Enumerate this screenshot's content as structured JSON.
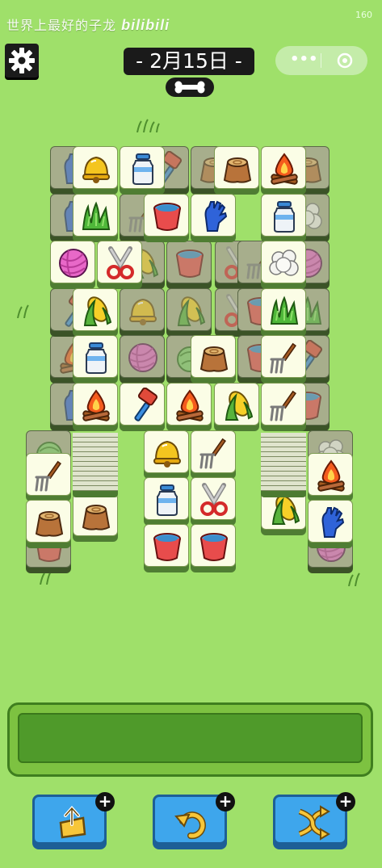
{
  "watermark": {
    "text": "世界上最好的子龙",
    "logo": "bilibili"
  },
  "corner_number": "160",
  "header": {
    "date_label": "- 2月15日 -",
    "settings_icon": "gear-icon",
    "menu_icons": [
      "more-dots-icon",
      "close-circle-icon"
    ],
    "bone_icon": "bone-icon"
  },
  "colors": {
    "background": "#9fe06a",
    "tile_face": "#fbfde6",
    "tile_base": "#4f7d33",
    "tray": "#4f9a2a",
    "tool_button": "#3ea6ec"
  },
  "board": {
    "tile_kinds": [
      "bell",
      "milk",
      "stump",
      "campfire",
      "grass",
      "bucket",
      "glove",
      "cotton",
      "yarn",
      "shears",
      "corn",
      "pitchfork",
      "brush",
      "cabbage"
    ],
    "visible_top_tiles": [
      "bell",
      "milk",
      "stump",
      "campfire",
      "grass",
      "bucket",
      "glove",
      "milk",
      "yarn",
      "shears",
      "cotton",
      "corn",
      "grass",
      "milk",
      "stump",
      "pitchfork",
      "campfire",
      "brush",
      "campfire",
      "corn",
      "pitchfork",
      "bell",
      "pitchfork",
      "pitchfork",
      "campfire",
      "corn",
      "stump",
      "stump",
      "milk",
      "shears",
      "glove",
      "bucket",
      "bucket"
    ]
  },
  "tray": {
    "slots_filled": 0
  },
  "tools": [
    {
      "name": "undo-out",
      "icon": "box-up-icon"
    },
    {
      "name": "undo",
      "icon": "undo-arrow-icon"
    },
    {
      "name": "shuffle",
      "icon": "shuffle-icon"
    }
  ]
}
